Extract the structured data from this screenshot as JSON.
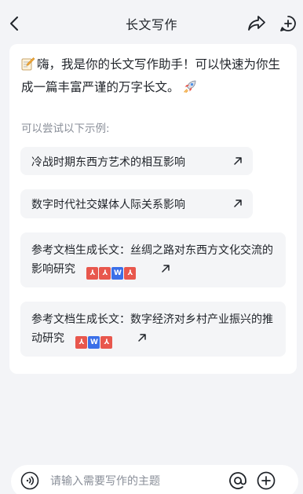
{
  "header": {
    "title": "长文写作",
    "icons": {
      "back": "chevron-left-icon",
      "share": "share-arrow-icon",
      "new_chat": "new-chat-plus-icon"
    }
  },
  "assistant": {
    "greeting": "嗨，我是你的长文写作助手！可以快速为你生成一篇丰富严谨的万字长文。",
    "icons": {
      "lead": "memo-pencil-icon",
      "trail": "rocket-icon"
    }
  },
  "examples": {
    "hint": "可以尝试以下示例:",
    "items": [
      {
        "label": "冷战时期东西方艺术的相互影响"
      },
      {
        "label": "数字时代社交媒体人际关系影响"
      },
      {
        "label": "参考文档生成长文：丝绸之路对东西方文化交流的影响研究",
        "files": [
          "pdf",
          "pdf",
          "doc",
          "pdf"
        ]
      },
      {
        "label": "参考文档生成长文：数字经济对乡村产业振兴的推动研究",
        "files": [
          "pdf",
          "doc",
          "pdf"
        ]
      }
    ]
  },
  "composer": {
    "placeholder": "请输入需要写作的主题",
    "icons": {
      "voice": "voice-icon",
      "mention": "at-icon",
      "add": "plus-circle-icon"
    }
  },
  "colors": {
    "background": "#f3f4f7",
    "card": "#ffffff",
    "chip": "#f4f5f7",
    "pdf": "#e8574d",
    "doc": "#3b6fe8",
    "muted": "#8a8f99"
  }
}
